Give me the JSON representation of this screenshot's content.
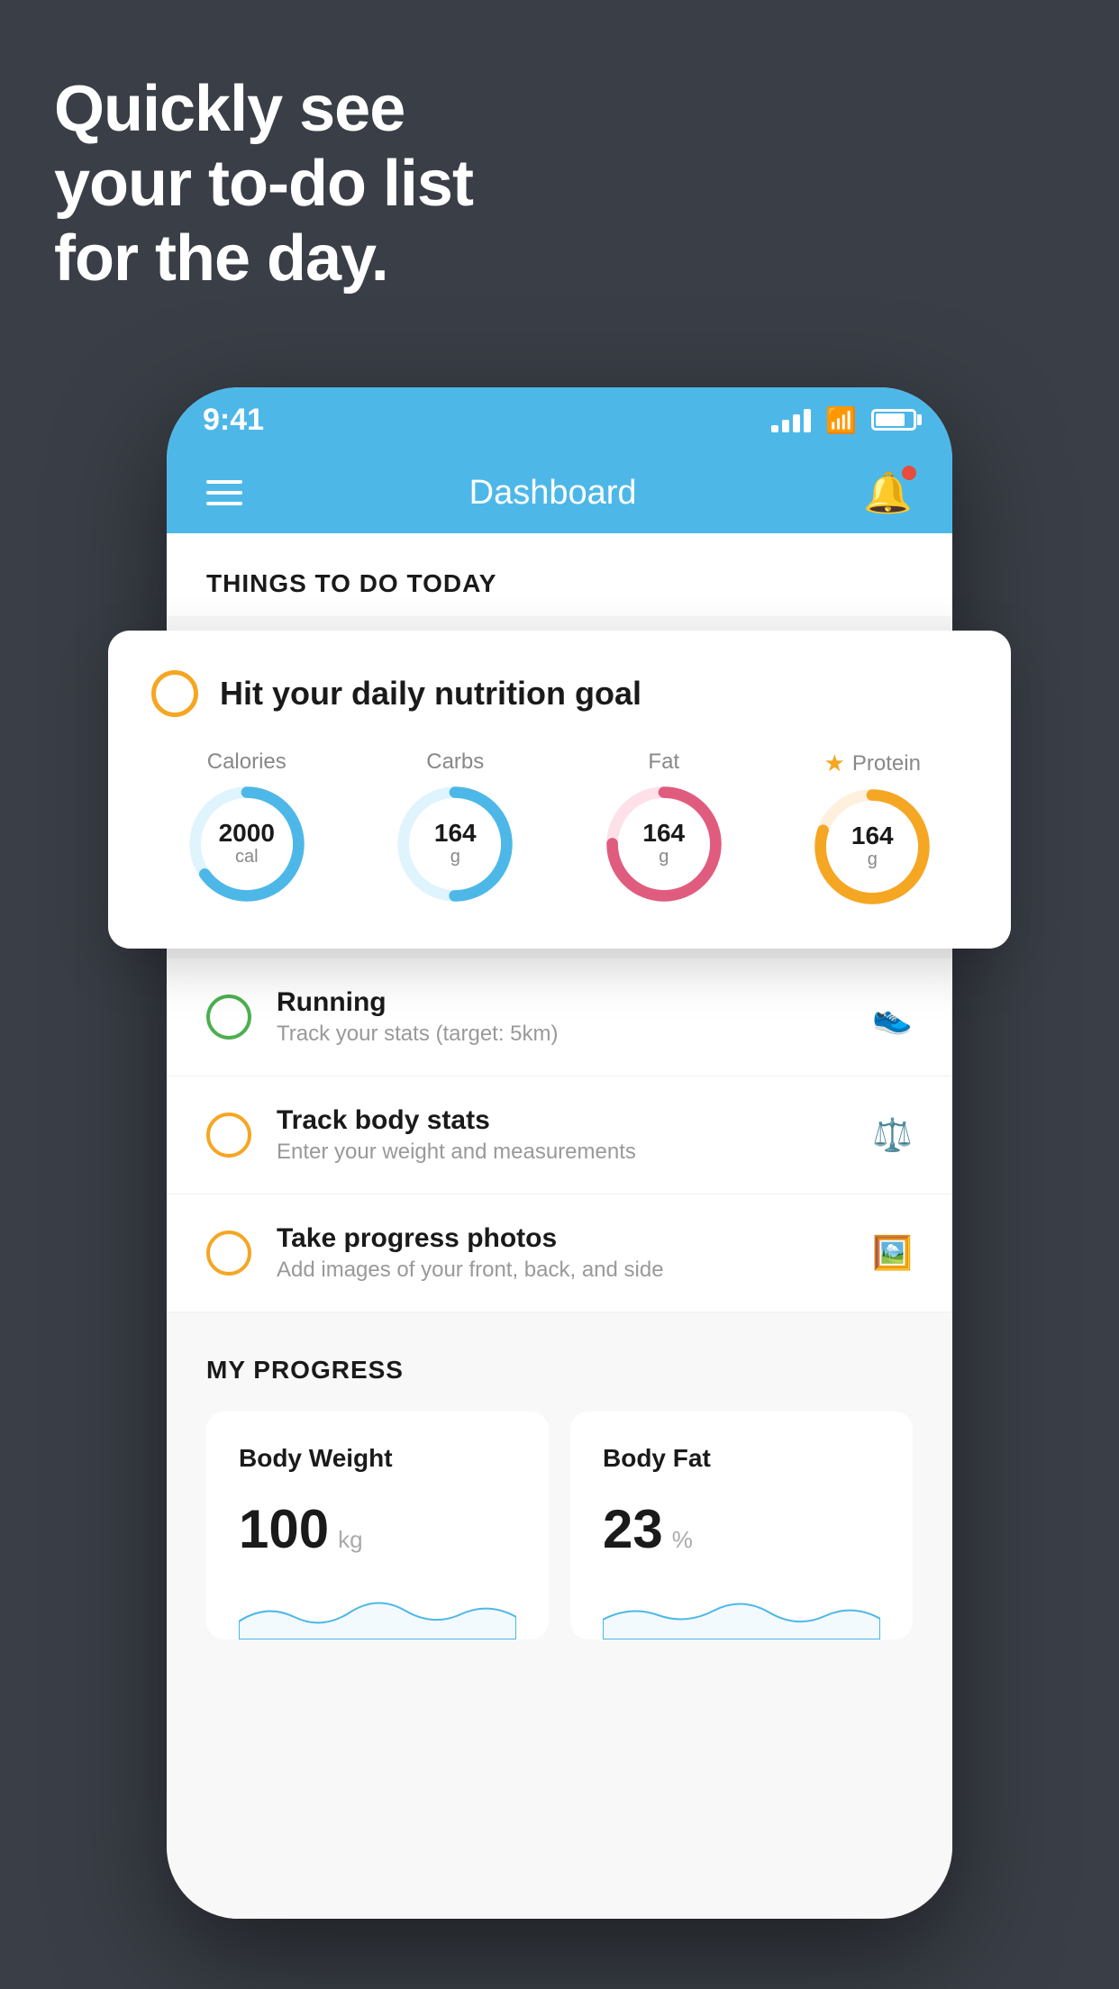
{
  "hero": {
    "line1": "Quickly see",
    "line2": "your to-do list",
    "line3": "for the day."
  },
  "statusBar": {
    "time": "9:41",
    "signalBars": [
      8,
      14,
      20,
      26
    ],
    "batteryPercent": 80
  },
  "appHeader": {
    "title": "Dashboard"
  },
  "sectionHeadings": {
    "thingsToDo": "THINGS TO DO TODAY",
    "myProgress": "MY PROGRESS"
  },
  "floatingCard": {
    "title": "Hit your daily nutrition goal",
    "items": [
      {
        "label": "Calories",
        "value": "2000",
        "unit": "cal",
        "color": "#4db8e8",
        "trackColor": "#e0f4fd",
        "progress": 0.65,
        "starred": false
      },
      {
        "label": "Carbs",
        "value": "164",
        "unit": "g",
        "color": "#4db8e8",
        "trackColor": "#e0f4fd",
        "progress": 0.5,
        "starred": false
      },
      {
        "label": "Fat",
        "value": "164",
        "unit": "g",
        "color": "#e05c7e",
        "trackColor": "#fde0e8",
        "progress": 0.75,
        "starred": false
      },
      {
        "label": "Protein",
        "value": "164",
        "unit": "g",
        "color": "#f5a623",
        "trackColor": "#fef0dc",
        "progress": 0.8,
        "starred": true
      }
    ]
  },
  "todoItems": [
    {
      "id": "running",
      "title": "Running",
      "subtitle": "Track your stats (target: 5km)",
      "circleColor": "green",
      "iconLabel": "shoe-icon"
    },
    {
      "id": "body-stats",
      "title": "Track body stats",
      "subtitle": "Enter your weight and measurements",
      "circleColor": "yellow",
      "iconLabel": "scale-icon"
    },
    {
      "id": "progress-photos",
      "title": "Take progress photos",
      "subtitle": "Add images of your front, back, and side",
      "circleColor": "yellow",
      "iconLabel": "photo-icon"
    }
  ],
  "progressCards": [
    {
      "id": "body-weight",
      "title": "Body Weight",
      "value": "100",
      "unit": "kg"
    },
    {
      "id": "body-fat",
      "title": "Body Fat",
      "value": "23",
      "unit": "%"
    }
  ]
}
